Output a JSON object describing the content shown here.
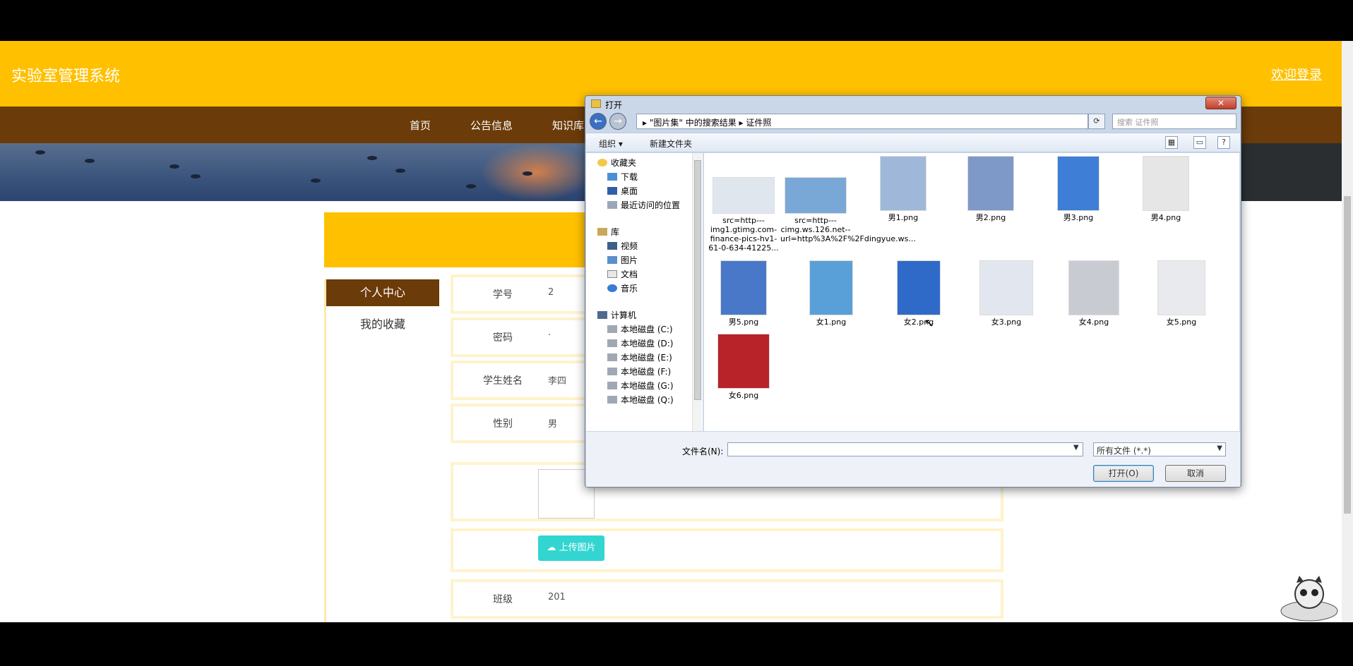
{
  "site": {
    "title": "实验室管理系统",
    "welcome": "欢迎登录"
  },
  "nav": {
    "items": [
      "首页",
      "公告信息",
      "知识库"
    ]
  },
  "sidebar": {
    "header": "个人中心",
    "items": [
      "我的收藏"
    ]
  },
  "form": {
    "rows": [
      {
        "label": "学号",
        "value": "2"
      },
      {
        "label": "密码",
        "value": "·"
      },
      {
        "label": "学生姓名",
        "value": "李四"
      },
      {
        "label": "性别",
        "value": "男"
      },
      {
        "label": "班级",
        "value": "201"
      }
    ],
    "upload_label": "上传图片"
  },
  "dialog": {
    "title": "打开",
    "close": "✕",
    "breadcrumb": "▸  \"图片集\" 中的搜索结果  ▸  证件照",
    "search_placeholder": "搜索 证件照",
    "toolbar": {
      "organize": "组织 ▾",
      "new_folder": "新建文件夹"
    },
    "tree": [
      {
        "label": "收藏夹",
        "icon": "star-icon"
      },
      {
        "label": "下载",
        "icon": "folder-icon"
      },
      {
        "label": "桌面",
        "icon": "desktop-icon"
      },
      {
        "label": "最近访问的位置",
        "icon": "recent-icon"
      },
      {
        "label": "库",
        "icon": "library-icon"
      },
      {
        "label": "视频",
        "icon": "video-icon"
      },
      {
        "label": "图片",
        "icon": "picture-icon"
      },
      {
        "label": "文档",
        "icon": "document-icon"
      },
      {
        "label": "音乐",
        "icon": "music-icon"
      },
      {
        "label": "计算机",
        "icon": "computer-icon"
      },
      {
        "label": "本地磁盘 (C:)",
        "icon": "disk-icon"
      },
      {
        "label": "本地磁盘 (D:)",
        "icon": "disk-icon"
      },
      {
        "label": "本地磁盘 (E:)",
        "icon": "disk-icon"
      },
      {
        "label": "本地磁盘 (F:)",
        "icon": "disk-icon"
      },
      {
        "label": "本地磁盘 (G:)",
        "icon": "disk-icon"
      },
      {
        "label": "本地磁盘 (Q:)",
        "icon": "disk-icon"
      }
    ],
    "files": [
      {
        "name": "src=http---img1.gtimg.com-finance-pics-hv1-61-0-634-41225...",
        "bg": "#dfe6ee"
      },
      {
        "name": "src=http---cimg.ws.126.net--url=http%3A%2F%2Fdingyue.ws...",
        "bg": "#7aa8d6"
      },
      {
        "name": "男1.png",
        "bg": "#9fb8d9"
      },
      {
        "name": "男2.png",
        "bg": "#7e98c8"
      },
      {
        "name": "男3.png",
        "bg": "#3e7ed6"
      },
      {
        "name": "男4.png",
        "bg": "#e6e6e6"
      },
      {
        "name": "男5.png",
        "bg": "#4a78c8"
      },
      {
        "name": "女1.png",
        "bg": "#5aa0d8"
      },
      {
        "name": "女2.png",
        "bg": "#2f6ac8"
      },
      {
        "name": "女3.png",
        "bg": "#e2e6ee"
      },
      {
        "name": "女4.png",
        "bg": "#c8ccd2"
      },
      {
        "name": "女5.png",
        "bg": "#e8eaee"
      },
      {
        "name": "女6.png",
        "bg": "#b8232a"
      }
    ],
    "filename_label": "文件名(N):",
    "filetype": "所有文件 (*.*)",
    "open_button": "打开(O)",
    "cancel_button": "取消"
  }
}
